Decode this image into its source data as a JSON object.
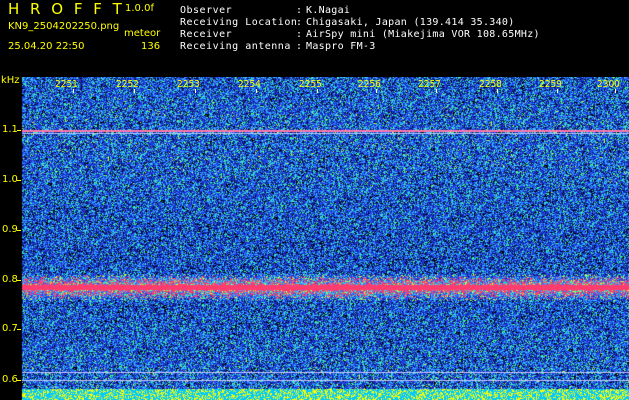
{
  "header": {
    "title": "H R O F F T",
    "version": "1.0.0f",
    "filename": "KN9_2504202250.png",
    "mode": "meteor",
    "datetime": "25.04.20 22:50",
    "count": "136"
  },
  "info": [
    {
      "label": "Observer",
      "value": "K.Nagai"
    },
    {
      "label": "Receiving Location",
      "value": "Chigasaki, Japan (139.414 35.340)"
    },
    {
      "label": "Receiver",
      "value": "AirSpy mini (Miakejima VOR 108.65MHz)"
    },
    {
      "label": "Receiving antenna",
      "value": "Maspro FM-3"
    }
  ],
  "axis": {
    "unit": "kHz",
    "x_ticks": [
      "2251",
      "2252",
      "2253",
      "2254",
      "2255",
      "2256",
      "2257",
      "2258",
      "2259",
      "2300"
    ],
    "y_ticks": [
      "1.1",
      "1.0",
      "0.9",
      "0.8",
      "0.7",
      "0.6"
    ]
  },
  "colors": {
    "background": "#000000",
    "label": "#ffff00",
    "text": "#ffffff",
    "signal": "#ff3070",
    "noise_low": "#1020c0",
    "noise_mid": "#3060ff",
    "noise_high": "#30c0ff",
    "green": "#40ff60"
  }
}
